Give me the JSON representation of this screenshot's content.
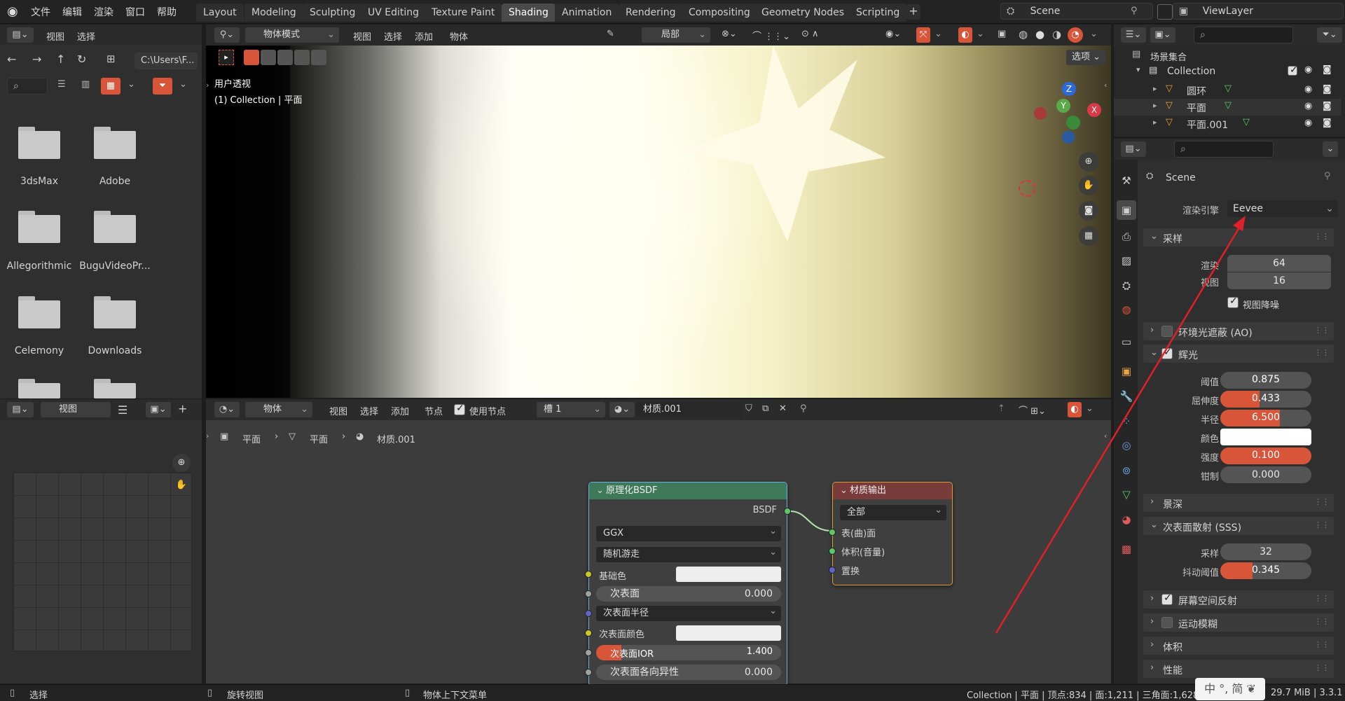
{
  "topbar": {
    "menus": [
      "文件",
      "编辑",
      "渲染",
      "窗口",
      "帮助"
    ],
    "workspaces": [
      "Layout",
      "Modeling",
      "Sculpting",
      "UV Editing",
      "Texture Paint",
      "Shading",
      "Animation",
      "Rendering",
      "Compositing",
      "Geometry Nodes",
      "Scripting"
    ],
    "active_workspace": "Shading",
    "scene": "Scene",
    "view_layer": "ViewLayer"
  },
  "file_browser": {
    "menu_view": "视图",
    "menu_select": "选择",
    "path": "C:\\Users\\F...",
    "folders": [
      "3dsMax",
      "Adobe",
      "Allegorithmic",
      "BuguVideoPr...",
      "Celemony",
      "Downloads"
    ]
  },
  "image_editor": {
    "view_label": "视图"
  },
  "viewport": {
    "mode": "物体模式",
    "menus": [
      "视图",
      "选择",
      "添加",
      "物体"
    ],
    "transform": "局部",
    "options": "选项",
    "overlay_title": "用户透视",
    "overlay_sub": "(1) Collection | 平面",
    "gizmo_z": "Z",
    "gizmo_y": "Y",
    "gizmo_x": "X"
  },
  "node_editor": {
    "mode": "物体",
    "menus": [
      "视图",
      "选择",
      "添加",
      "节点"
    ],
    "use_nodes": "使用节点",
    "slot": "槽 1",
    "material": "材质.001",
    "breadcrumb": [
      "平面",
      "平面",
      "材质.001"
    ],
    "bsdf": {
      "title": "原理化BSDF",
      "output": "BSDF",
      "distribution": "GGX",
      "subsurface_method": "随机游走",
      "base_color": "基础色",
      "subsurface": "次表面",
      "subsurface_val": "0.000",
      "subsurface_radius": "次表面半径",
      "subsurface_color": "次表面颜色",
      "subsurface_ior": "次表面IOR",
      "subsurface_ior_val": "1.400",
      "subsurface_aniso": "次表面各向异性",
      "subsurface_aniso_val": "0.000"
    },
    "output": {
      "title": "材质输出",
      "target": "全部",
      "surface": "表(曲)面",
      "volume": "体积(音量)",
      "displacement": "置换"
    }
  },
  "outliner": {
    "scene_collection": "场景集合",
    "collection": "Collection",
    "items": [
      "圆环",
      "平面",
      "平面.001"
    ]
  },
  "properties": {
    "scene": "Scene",
    "render_engine_label": "渲染引擎",
    "render_engine": "Eevee",
    "sampling": {
      "title": "采样",
      "render_label": "渲染",
      "render": "64",
      "viewport_label": "视图",
      "viewport": "16",
      "denoise": "视图降噪"
    },
    "ao": "环境光遮蔽 (AO)",
    "bloom": {
      "title": "辉光",
      "threshold_label": "阈值",
      "threshold": "0.875",
      "threshold_fill": 0.0,
      "knee_label": "屈伸度",
      "knee": "0.433",
      "knee_fill": 0.43,
      "radius_label": "半径",
      "radius": "6.500",
      "radius_fill": 0.65,
      "color_label": "颜色",
      "intensity_label": "强度",
      "intensity": "0.100",
      "intensity_fill": 1.0,
      "clamp_label": "钳制",
      "clamp": "0.000"
    },
    "dof": "景深",
    "sss": {
      "title": "次表面散射 (SSS)",
      "samples_label": "采样",
      "samples": "32",
      "jitter_label": "抖动阈值",
      "jitter": "0.345",
      "jitter_fill": 0.35
    },
    "ssr": "屏幕空间反射",
    "motion_blur": "运动模糊",
    "volumetrics": "体积",
    "performance": "性能"
  },
  "statusbar": {
    "select": "选择",
    "rotate": "旋转视图",
    "context": "物体上下文菜单",
    "stats": "Collection | 平面 | 顶点:834 | 面:1,211 | 三角面:1,628",
    "memory": "29.7 MiB | 3.3.1",
    "ime": "中 °, 简 ❦"
  },
  "colors": {
    "accent": "#d8553a",
    "arrow": "#e0202a",
    "node_bsdf_header": "#3e7a5a",
    "node_output_header": "#7a3b3b"
  }
}
